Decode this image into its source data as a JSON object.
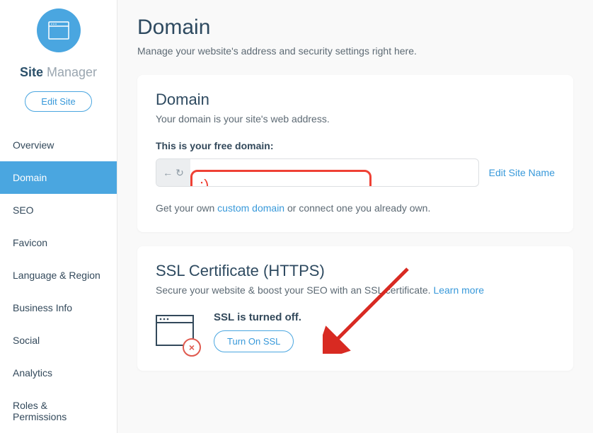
{
  "brand": {
    "bold": "Site",
    "light": "Manager"
  },
  "edit_site_label": "Edit Site",
  "nav": [
    {
      "label": "Overview",
      "active": false
    },
    {
      "label": "Domain",
      "active": true
    },
    {
      "label": "SEO",
      "active": false
    },
    {
      "label": "Favicon",
      "active": false
    },
    {
      "label": "Language & Region",
      "active": false
    },
    {
      "label": "Business Info",
      "active": false
    },
    {
      "label": "Social",
      "active": false
    },
    {
      "label": "Analytics",
      "active": false
    },
    {
      "label": "Roles & Permissions",
      "active": false
    }
  ],
  "page": {
    "title": "Domain",
    "subtitle": "Manage your website's address and security settings right here."
  },
  "domain_card": {
    "title": "Domain",
    "desc": "Your domain is your site's web address.",
    "label": "This is your free domain:",
    "highlight_text": ":)",
    "edit_link": "Edit Site Name",
    "help_pre": "Get your own ",
    "help_link": "custom domain",
    "help_post": " or connect one you already own."
  },
  "ssl_card": {
    "title": "SSL Certificate (HTTPS)",
    "desc_pre": "Secure your website & boost your SEO with an SSL certificate. ",
    "learn_more": "Learn more",
    "status": "SSL is turned off.",
    "button": "Turn On SSL",
    "badge": "×"
  }
}
